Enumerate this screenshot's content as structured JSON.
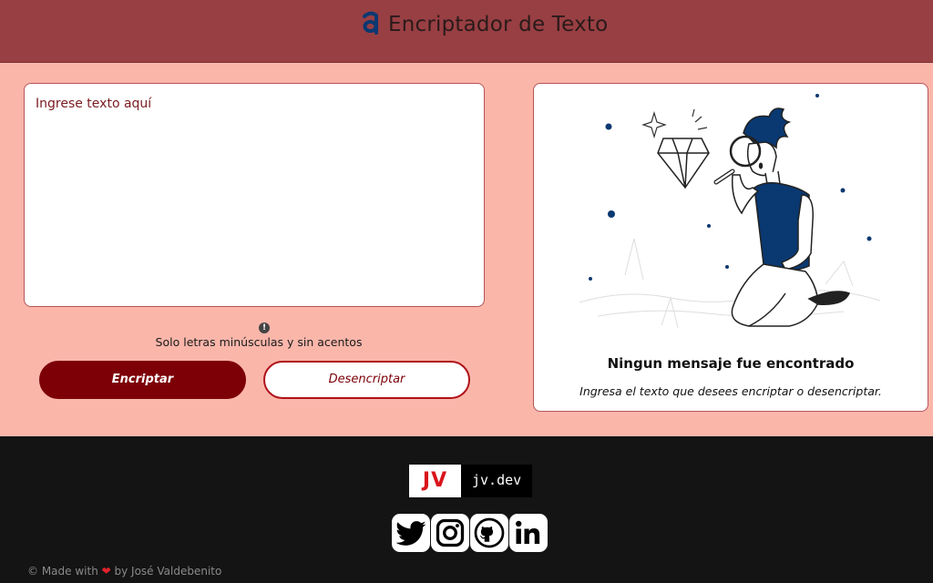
{
  "header": {
    "title": "Encriptador de Texto",
    "logo_icon": "a-logo-icon"
  },
  "input": {
    "placeholder": "Ingrese texto aquí",
    "value": ""
  },
  "hint": {
    "text": "Solo letras minúsculas y sin acentos"
  },
  "buttons": {
    "encrypt": "Encriptar",
    "decrypt": "Desencriptar"
  },
  "output": {
    "title": "Ningun mensaje fue encontrado",
    "subtitle": "Ingresa el texto que desees encriptar o desencriptar."
  },
  "footer": {
    "brand_mark": "JV",
    "brand_domain": "jv.dev",
    "socials": [
      "twitter-icon",
      "instagram-icon",
      "github-icon",
      "linkedin-icon"
    ],
    "made_prefix": "© Made with",
    "made_suffix": "by José Valdebenito"
  },
  "colors": {
    "header": "#983f43",
    "background": "#fbb6aa",
    "primary": "#7d0007",
    "accent": "#0a3871",
    "footer": "#141414"
  }
}
